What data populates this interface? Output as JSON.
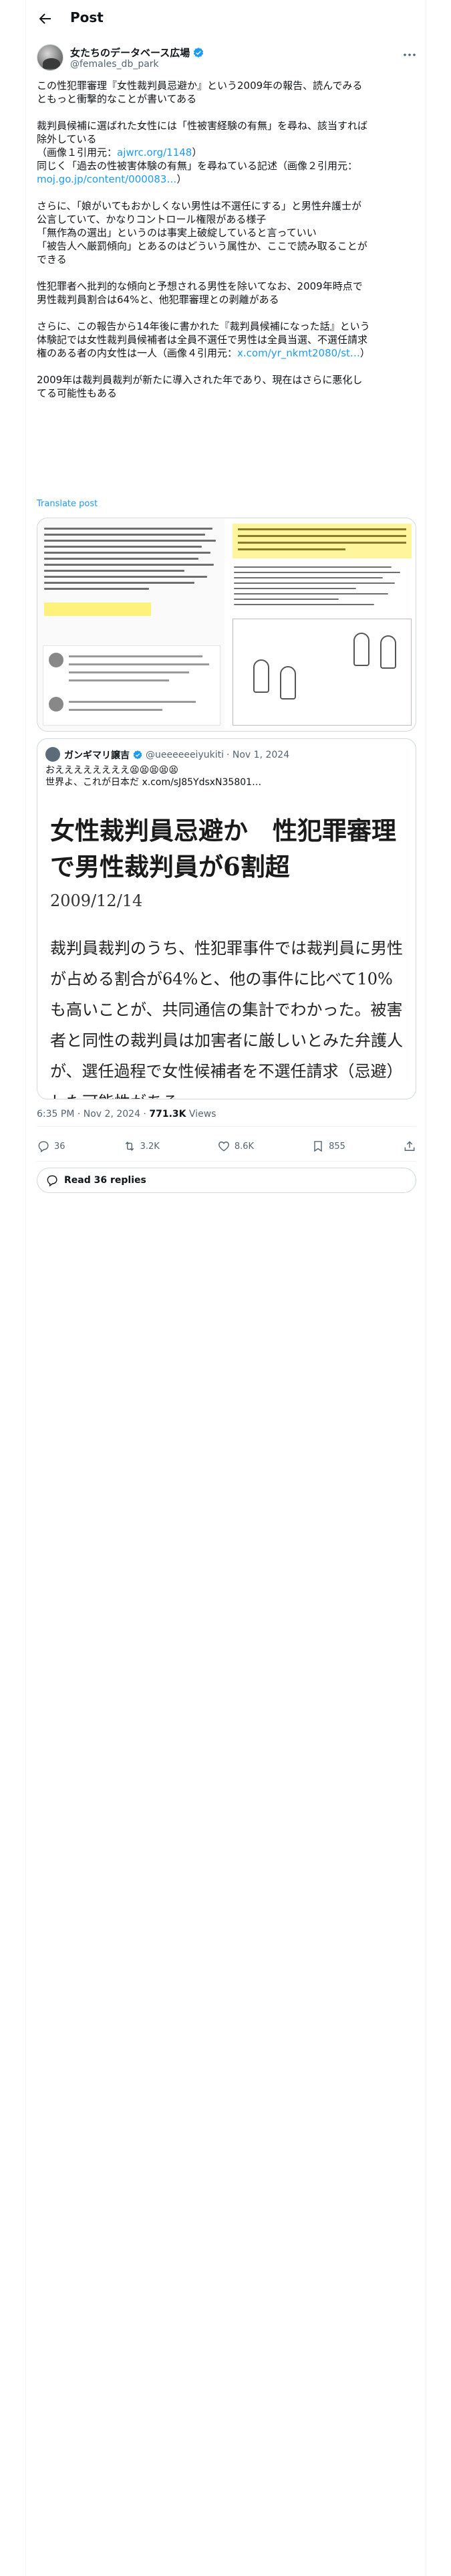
{
  "header": {
    "title": "Post"
  },
  "author": {
    "name": "女たちのデータベース広場",
    "handle": "@females_db_park"
  },
  "post": {
    "paragraphs": [
      [
        "この性犯罪審理『女性裁判員忌避か』という2009年の報告、読んでみる",
        "ともっと衝撃的なことが書いてある"
      ],
      [
        "裁判員候補に選ばれた女性には「性被害経験の有無」を尋ね、該当すれば",
        "除外している",
        "（画像１引用元：",
        "同じく「過去の性被害体験の有無」を尋ねている記述（画像２引用元：",
        ""
      ],
      [
        "さらに、「娘がいてもおかしくない男性は不選任にする」と男性弁護士が",
        "公言していて、かなりコントロール権限がある様子",
        "「無作為の選出」というのは事実上破綻していると言っていい",
        "「被告人へ厳罰傾向」とあるのはどういう属性か、ここで読み取ることが",
        "できる"
      ],
      [
        "性犯罪者へ批判的な傾向と予想される男性を除いてなお、2009年時点で",
        "男性裁判員割合は64%と、他犯罪審理との剥離がある"
      ],
      [
        "さらに、この報告から14年後に書かれた『裁判員候補になった話』という",
        "体験記では女性裁判員候補者は全員不選任で男性は全員当選、不選任請求",
        "権のある者の内女性は一人（画像４引用元：",
        ""
      ],
      [
        "2009年は裁判員裁判が新たに導入された年であり、現在はさらに悪化し",
        "てる可能性もある"
      ]
    ],
    "link1": "ajwrc.org/1148",
    "link1_suffix": "）",
    "link2": "moj.go.jp/content/000083…",
    "link2_suffix": "）",
    "link3": "x.com/yr_nkmt2080/st…",
    "link3_suffix": "）",
    "translate_label": "Translate post"
  },
  "quote": {
    "name": "ガンギマリ譲吉",
    "handle": "@ueeeeeeiyukiti",
    "date": "· Nov 1, 2024",
    "text_line1": "おええええええええ😫😫😫😫😫",
    "text_line2": "世界よ、これが日本だ x.com/sJ85YdsxN35801…",
    "article_headline": "女性裁判員忌避か　性犯罪審理で男性裁判員が6割超",
    "article_date": "2009/12/14",
    "article_body": "裁判員裁判のうち、性犯罪事件では裁判員に男性が占める割合が64%と、他の事件に比べて10%も高いことが、共同通信の集計でわかった。被害者と同性の裁判員は加害者に厳しいとみた弁護人が、選任過程で女性候補者を不選任請求（忌避）した可能性がある。"
  },
  "meta": {
    "time": "6:35 PM · Nov 2, 2024",
    "sep": " · ",
    "views_count": "771.3K",
    "views_label": " Views"
  },
  "actions": {
    "replies": "36",
    "reposts": "3.2K",
    "likes": "8.6K",
    "bookmarks": "855"
  },
  "read_replies": "Read 36 replies",
  "colors": {
    "link": "#1d9bf0",
    "verified": "#1d9bf0",
    "muted": "#536471"
  }
}
